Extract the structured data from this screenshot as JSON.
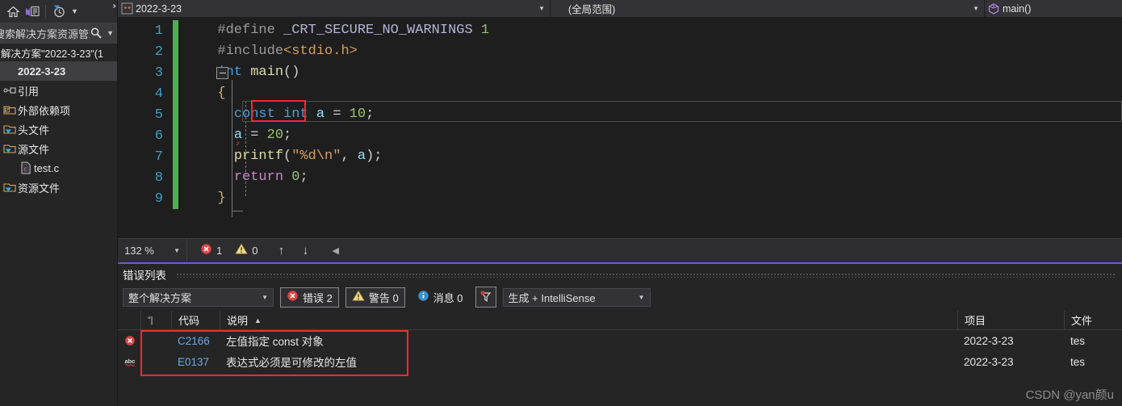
{
  "sidebar": {
    "toolbar": {
      "home_icon": "home-icon",
      "nav_icon": "vs-navigate-icon",
      "pending_changes_icon": "clock-filter-icon",
      "dropdown_icon": "chevron-down-icon",
      "overflow_icon": "double-chevron-icon"
    },
    "search": {
      "text": "搜索解决方案资源管理器",
      "search_icon": "search-icon",
      "dropdown_icon": "chevron-down-icon"
    },
    "solution_label": "解决方案\"2022-3-23\"(1",
    "tree": [
      {
        "label": "2022-3-23",
        "icon": "project-icon",
        "selected": true,
        "indent": 0
      },
      {
        "label": "引用",
        "icon": "references-icon",
        "selected": false,
        "indent": 0
      },
      {
        "label": "外部依赖项",
        "icon": "external-dependencies-icon",
        "selected": false,
        "indent": 0
      },
      {
        "label": "头文件",
        "icon": "header-folder-icon",
        "selected": false,
        "indent": 0
      },
      {
        "label": "源文件",
        "icon": "source-folder-icon",
        "selected": false,
        "indent": 0
      },
      {
        "label": "test.c",
        "icon": "c-file-icon",
        "selected": false,
        "indent": 1
      },
      {
        "label": "资源文件",
        "icon": "resource-folder-icon",
        "selected": false,
        "indent": 0
      }
    ]
  },
  "navbar": {
    "project": "2022-3-23",
    "project_icon": "cpp-project-icon",
    "scope": "(全局范围)",
    "function": "main()",
    "function_icon": "method-cube-icon",
    "dropdown_icon": "chevron-down-icon"
  },
  "editor": {
    "lines": [
      {
        "num": "1",
        "tokens": [
          {
            "t": "#define ",
            "c": "k-pre"
          },
          {
            "t": "_CRT_SECURE_NO_WARNINGS",
            "c": "k-mac"
          },
          {
            "t": " ",
            "c": "k-plain"
          },
          {
            "t": "1",
            "c": "k-num"
          }
        ]
      },
      {
        "num": "2",
        "tokens": [
          {
            "t": "#include",
            "c": "k-pre"
          },
          {
            "t": "<stdio.h>",
            "c": "k-inc"
          }
        ]
      },
      {
        "num": "3",
        "tokens": [
          {
            "t": "int",
            "c": "k-kw"
          },
          {
            "t": " ",
            "c": "k-plain"
          },
          {
            "t": "main",
            "c": "k-fn"
          },
          {
            "t": "()",
            "c": "k-op"
          }
        ]
      },
      {
        "num": "4",
        "tokens": [
          {
            "t": "{",
            "c": "k-br"
          }
        ]
      },
      {
        "num": "5",
        "tokens": [
          {
            "t": "const",
            "c": "k-kw"
          },
          {
            "t": " ",
            "c": "k-plain"
          },
          {
            "t": "int",
            "c": "k-kw"
          },
          {
            "t": " ",
            "c": "k-plain"
          },
          {
            "t": "a",
            "c": "k-id"
          },
          {
            "t": " = ",
            "c": "k-op"
          },
          {
            "t": "10",
            "c": "k-num"
          },
          {
            "t": ";",
            "c": "k-op"
          }
        ]
      },
      {
        "num": "6",
        "tokens": [
          {
            "t": "a",
            "c": "k-id"
          },
          {
            "t": " = ",
            "c": "k-op"
          },
          {
            "t": "20",
            "c": "k-num"
          },
          {
            "t": ";",
            "c": "k-op"
          }
        ]
      },
      {
        "num": "7",
        "tokens": [
          {
            "t": "printf",
            "c": "k-fn"
          },
          {
            "t": "(",
            "c": "k-op"
          },
          {
            "t": "\"%d",
            "c": "k-str"
          },
          {
            "t": "\\n",
            "c": "k-esc"
          },
          {
            "t": "\"",
            "c": "k-str"
          },
          {
            "t": ", ",
            "c": "k-op"
          },
          {
            "t": "a",
            "c": "k-id"
          },
          {
            "t": ");",
            "c": "k-op"
          }
        ]
      },
      {
        "num": "8",
        "tokens": [
          {
            "t": "return",
            "c": "k-ret"
          },
          {
            "t": " ",
            "c": "k-plain"
          },
          {
            "t": "0",
            "c": "k-num"
          },
          {
            "t": ";",
            "c": "k-op"
          }
        ]
      },
      {
        "num": "9",
        "tokens": [
          {
            "t": "}",
            "c": "k-br"
          }
        ]
      }
    ],
    "highlight_token": "const",
    "collapse_icon": "collapse-minus-icon"
  },
  "editor_status": {
    "zoom": "132 %",
    "zoom_dropdown_icon": "chevron-down-icon",
    "error_icon": "error-circle-icon",
    "error_count": "1",
    "warning_icon": "warning-triangle-icon",
    "warning_count": "0",
    "prev_icon": "arrow-up-icon",
    "next_icon": "arrow-down-icon",
    "collapse_icon": "left-triangle-icon"
  },
  "error_list": {
    "title": "错误列表",
    "scope_filter": "整个解决方案",
    "errors_label": "错误 2",
    "warnings_label": "警告 0",
    "messages_label": "消息 0",
    "filter_icon": "error-filter-icon",
    "build_filter": "生成 + IntelliSense",
    "dropdown_icon": "chevron-down-icon",
    "columns": [
      {
        "label": "",
        "name": "icon-column"
      },
      {
        "label": "",
        "name": "pin-column"
      },
      {
        "label": "代码",
        "name": "code-column"
      },
      {
        "label": "说明",
        "name": "description-column",
        "sort": "▲"
      },
      {
        "label": "项目",
        "name": "project-column"
      },
      {
        "label": "文件",
        "name": "file-column"
      }
    ],
    "rows": [
      {
        "icon": "error-circle-icon",
        "code": "C2166",
        "description": "左值指定 const 对象",
        "project": "2022-3-23",
        "file": "tes"
      },
      {
        "icon": "intellisense-abc-icon",
        "code": "E0137",
        "description": "表达式必须是可修改的左值",
        "project": "2022-3-23",
        "file": "tes"
      }
    ]
  },
  "watermark": "CSDN @yan颜u",
  "colors": {
    "accent_panel": "#6a5acd",
    "error_red": "#e02b2b",
    "highlight_box": "#f42b2b",
    "changebar_green": "#4caf50",
    "link_blue": "#6aa9e0"
  }
}
